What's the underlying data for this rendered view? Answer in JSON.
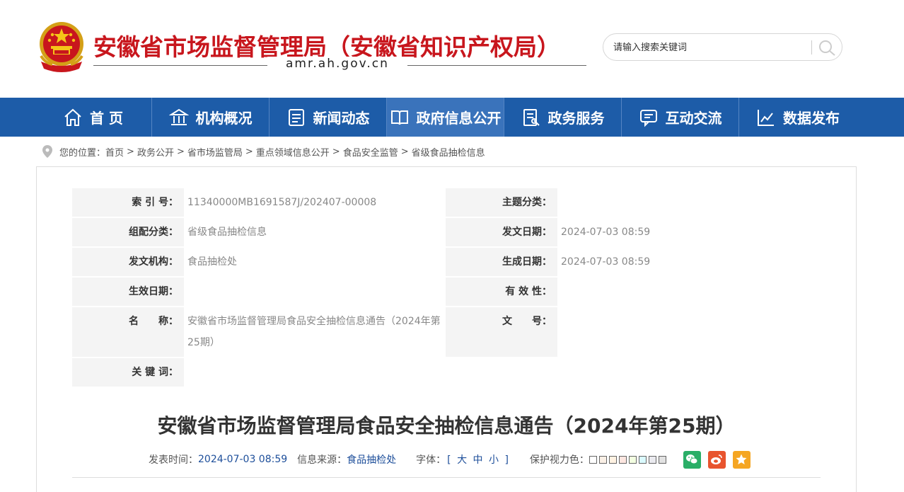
{
  "header": {
    "site_title": "安徽省市场监督管理局（安徽省知识产权局）",
    "domain": "amr.ah.gov.cn",
    "search_placeholder": "请输入搜索关键词",
    "brand_color": "#c8161d"
  },
  "nav": {
    "items": [
      {
        "label": "首 页",
        "icon": "home-icon"
      },
      {
        "label": "机构概况",
        "icon": "institution-icon"
      },
      {
        "label": "新闻动态",
        "icon": "news-icon"
      },
      {
        "label": "政府信息公开",
        "icon": "open-book-icon",
        "active": true
      },
      {
        "label": "政务服务",
        "icon": "service-form-icon"
      },
      {
        "label": "互动交流",
        "icon": "chat-icon"
      },
      {
        "label": "数据发布",
        "icon": "line-chart-icon"
      }
    ],
    "bg_color": "#1d5ca8"
  },
  "breadcrumb": {
    "prefix": "您的位置：",
    "items": [
      "首页",
      "政务公开",
      "省市场监管局",
      "重点领域信息公开",
      "食品安全监管",
      "省级食品抽检信息"
    ]
  },
  "meta": {
    "index_label": "索 引 号：",
    "index_value": "11340000MB1691587J/202407-00008",
    "topic_label": "主题分类：",
    "topic_value": "",
    "group_label": "组配分类：",
    "group_value": "省级食品抽检信息",
    "pubdate_label": "发文日期：",
    "pubdate_value": "2024-07-03 08:59",
    "org_label": "发文机构：",
    "org_value": "食品抽检处",
    "gendate_label": "生成日期：",
    "gendate_value": "2024-07-03 08:59",
    "effdate_label": "生效日期：",
    "effdate_value": "",
    "validity_label": "有 效 性：",
    "validity_value": "",
    "name_label": "名　　称：",
    "name_value": "安徽省市场监督管理局食品安全抽检信息通告（2024年第25期）",
    "docno_label": "文　　号：",
    "docno_value": "",
    "keyword_label": "关 键 词：",
    "keyword_value": ""
  },
  "article": {
    "title": "安徽省市场监督管理局食品安全抽检信息通告（2024年第25期）",
    "time_label": "发表时间：",
    "time_value": "2024-07-03 08:59",
    "source_label": "信息来源：",
    "source_value": "食品抽检处",
    "font_label": "字体：",
    "font_open": "[",
    "font_large": "大",
    "font_mid": "中",
    "font_small": "小",
    "font_close": "]",
    "eye_label": "保护视力色：",
    "swatches": [
      "#ffffff",
      "#faf0e6",
      "#fff2e2",
      "#fde6e0",
      "#f3ffe1",
      "#dafaff",
      "#eaeaef",
      "#e2e2e2"
    ]
  }
}
